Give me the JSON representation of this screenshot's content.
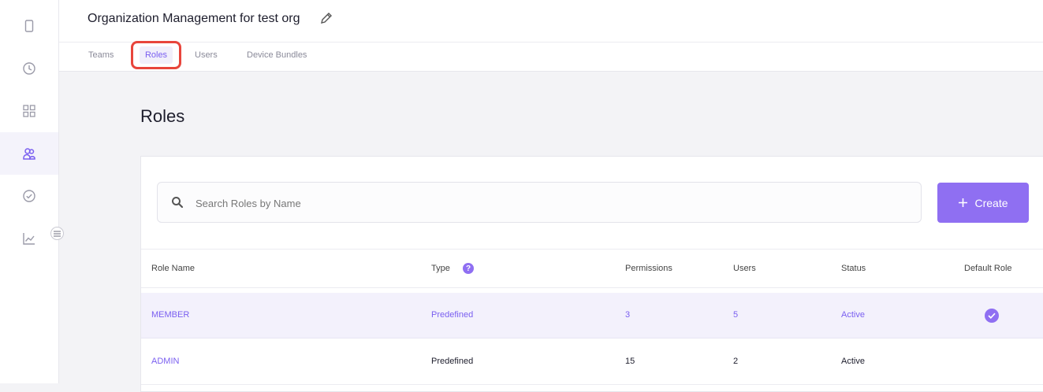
{
  "header": {
    "title": "Organization Management for test org"
  },
  "tabs": [
    {
      "label": "Teams"
    },
    {
      "label": "Roles"
    },
    {
      "label": "Users"
    },
    {
      "label": "Device Bundles"
    }
  ],
  "main": {
    "heading": "Roles",
    "search": {
      "placeholder": "Search Roles by Name",
      "value": ""
    },
    "create_label": "Create"
  },
  "table": {
    "columns": [
      "Role Name",
      "Type",
      "Permissions",
      "Users",
      "Status",
      "Default Role"
    ],
    "type_help": "?",
    "rows": [
      {
        "role_name": "MEMBER",
        "type": "Predefined",
        "permissions": "3",
        "users": "5",
        "status": "Active",
        "default": true
      },
      {
        "role_name": "ADMIN",
        "type": "Predefined",
        "permissions": "15",
        "users": "2",
        "status": "Active",
        "default": false
      }
    ]
  },
  "sidebar": {
    "items": [
      {
        "icon": "device-icon"
      },
      {
        "icon": "clock-icon"
      },
      {
        "icon": "grid-icon"
      },
      {
        "icon": "users-icon",
        "active": true
      },
      {
        "icon": "check-circle-icon"
      },
      {
        "icon": "chart-icon"
      }
    ]
  },
  "colors": {
    "accent": "#8f6ff2",
    "highlight": "#e8453c"
  }
}
